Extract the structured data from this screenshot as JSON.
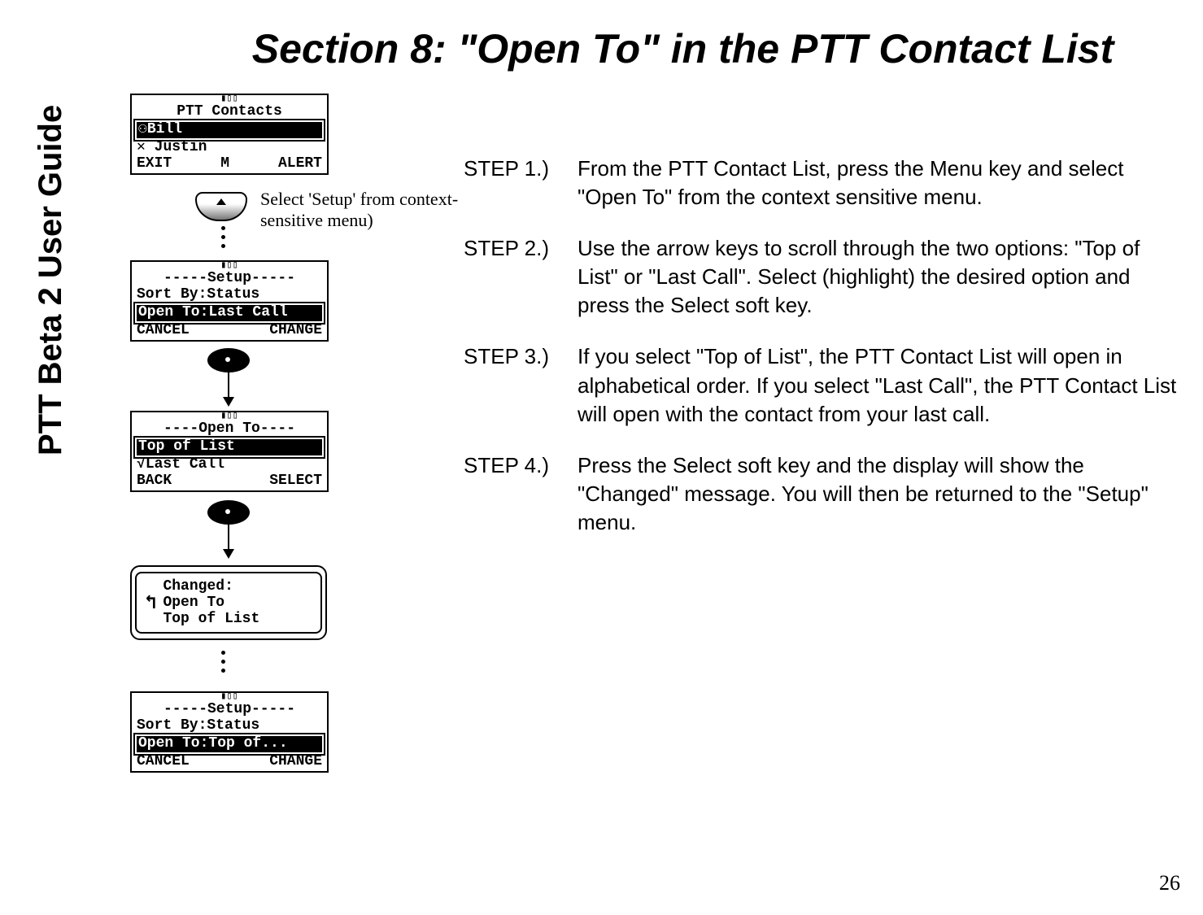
{
  "sidebar_title": "PTT Beta 2 User Guide",
  "page_title": "Section 8: \"Open To\" in the PTT Contact List",
  "page_number": "26",
  "annotation": "Select 'Setup' from context-sensitive menu)",
  "steps": [
    {
      "label": "STEP 1.)",
      "body": "From the PTT Contact List, press the Menu key and select \"Open To\" from the context sensitive menu."
    },
    {
      "label": "STEP 2.)",
      "body": "Use the arrow keys to scroll through the two options: \"Top of List\" or \"Last Call\".  Select (highlight) the desired option and press the Select soft key."
    },
    {
      "label": "STEP 3.)",
      "body": "If you select \"Top of List\", the PTT Contact List will open in alphabetical order.  If you select \"Last Call\", the PTT Contact List will open with the contact from your last call."
    },
    {
      "label": "STEP 4.)",
      "body": "Press the Select soft key and the display will show the \"Changed\" message.  You will then be returned to the \"Setup\" menu."
    }
  ],
  "screens": {
    "contacts": {
      "title": "PTT Contacts",
      "row_highlighted": "Bill",
      "row_plain": "Justin",
      "soft_left": "EXIT",
      "soft_mid": "M",
      "soft_right": "ALERT"
    },
    "setup1": {
      "title": "-----Setup-----",
      "row_plain": "Sort By:Status",
      "row_highlighted": "Open To:Last Call",
      "soft_left": "CANCEL",
      "soft_right": "CHANGE"
    },
    "open_to": {
      "title": "----Open To----",
      "row_highlighted": "Top of List",
      "row_plain": "Last Call",
      "check": "√",
      "soft_left": "BACK",
      "soft_right": "SELECT"
    },
    "changed": {
      "line1": "Changed:",
      "line2": "Open To",
      "line3": "Top of List"
    },
    "setup2": {
      "title": "-----Setup-----",
      "row_plain": "Sort By:Status",
      "row_highlighted": "Open To:Top of...",
      "soft_left": "CANCEL",
      "soft_right": "CHANGE"
    }
  }
}
